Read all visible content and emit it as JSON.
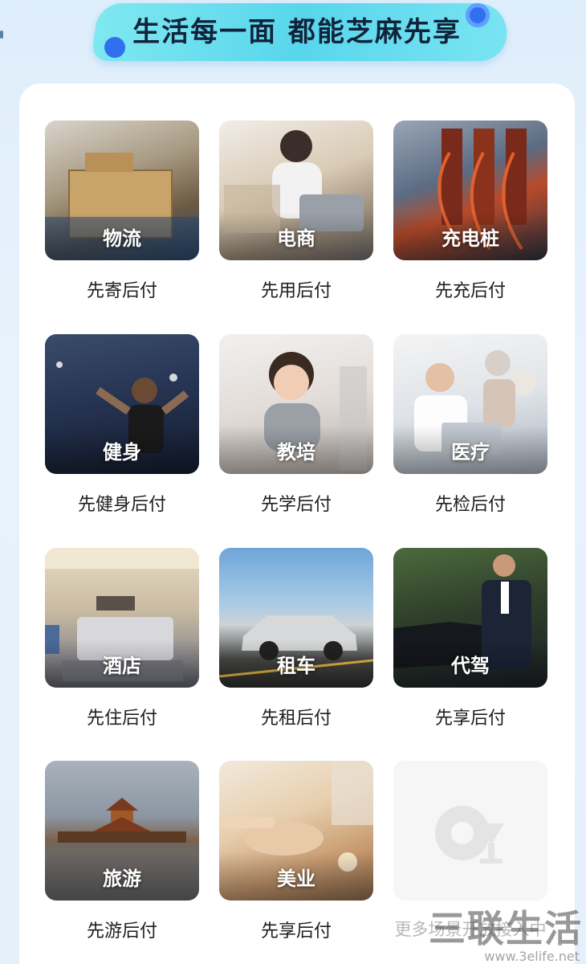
{
  "header": {
    "title": "生活每一面 都能芝麻先享"
  },
  "tiles": [
    {
      "label": "物流",
      "caption": "先寄后付"
    },
    {
      "label": "电商",
      "caption": "先用后付"
    },
    {
      "label": "充电桩",
      "caption": "先充后付"
    },
    {
      "label": "健身",
      "caption": "先健身后付"
    },
    {
      "label": "教培",
      "caption": "先学后付"
    },
    {
      "label": "医疗",
      "caption": "先检后付"
    },
    {
      "label": "酒店",
      "caption": "先住后付"
    },
    {
      "label": "租车",
      "caption": "先租后付"
    },
    {
      "label": "代驾",
      "caption": "先享后付"
    },
    {
      "label": "旅游",
      "caption": "先游后付"
    },
    {
      "label": "美业",
      "caption": "先享后付"
    },
    {
      "label": "",
      "caption": "更多场景开放接入中"
    }
  ],
  "watermark": {
    "text": "三联生活",
    "url": "www.3elife.net"
  },
  "colors": {
    "accent": "#2f6ff0",
    "banner": "#58d6ec",
    "background": "#e6f0fb",
    "card": "#ffffff"
  }
}
